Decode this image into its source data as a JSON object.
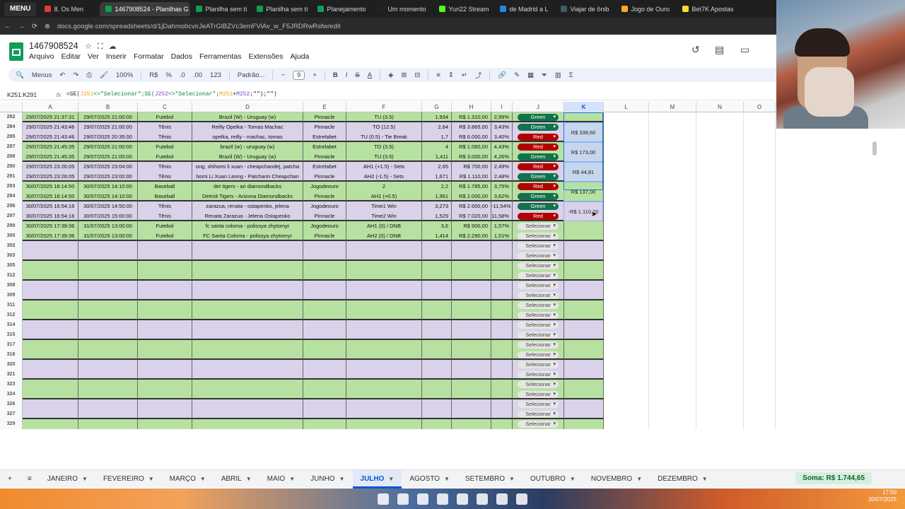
{
  "browser": {
    "menu_label": "MENU",
    "tabs": [
      {
        "label": "8. Os Men",
        "color": "#e53935"
      },
      {
        "label": "1467908524 - Planilhas G",
        "color": "#0f9d58",
        "active": true
      },
      {
        "label": "Planilha sem tí",
        "color": "#0f9d58"
      },
      {
        "label": "Planilha sem tí",
        "color": "#0f9d58"
      },
      {
        "label": "Planejamento",
        "color": "#0f9d58"
      },
      {
        "label": "Um momento",
        "color": "#222222"
      },
      {
        "label": "Yuri22 Stream",
        "color": "#53fc18"
      },
      {
        "label": "de Madrid a L",
        "color": "#1e88e5"
      },
      {
        "label": "Viajar de ônib",
        "color": "#455a64"
      },
      {
        "label": "Jogo de Ouro",
        "color": "#f9a825"
      },
      {
        "label": "Bet7K Apostas",
        "color": "#fdd835"
      }
    ],
    "url": "docs.google.com/spreadsheets/d/1jDahmobcvirJeATrGlBZVc3emFVlAv_w_F5JRDRwRsfw/edit"
  },
  "doc": {
    "title": "1467908524",
    "menus": [
      "Arquivo",
      "Editar",
      "Ver",
      "Inserir",
      "Formatar",
      "Dados",
      "Ferramentas",
      "Extensões",
      "Ajuda"
    ]
  },
  "toolbar": {
    "search": "Menus",
    "zoom": "100%",
    "currency": "R$",
    "percent": "%",
    "dec_less": ".0",
    "dec_more": ".00",
    "num_format": "123",
    "font": "Padrão...",
    "font_size": "9"
  },
  "formula_bar": {
    "name_box": "K251:K291",
    "fx": "fx",
    "f1": "=SE(",
    "f2": "J251",
    "f3": "<>\"Selecionar\";SE(",
    "f4": "J252",
    "f5": "<>\"Selecionar\";",
    "f6": "M251",
    "f7": "+",
    "f8": "M252",
    "f9": ";\"\");\"\")"
  },
  "columns": [
    "A",
    "B",
    "C",
    "D",
    "E",
    "F",
    "G",
    "H",
    "I",
    "J",
    "K",
    "L",
    "M",
    "N",
    "O"
  ],
  "rows": [
    {
      "n": "282",
      "a": "29/07/2025 21:37:31",
      "b": "29/07/2025 21:00:00",
      "c": "Futebol",
      "d": "Brazil (W) - Uruguay (w)",
      "e": "Pinnacle",
      "f": "TU (3.5)",
      "g": "1,934",
      "h": "R$ 1.310,00",
      "i": "2,99%",
      "j": "Green",
      "bg": "g",
      "end": true
    },
    {
      "n": "284",
      "a": "29/07/2025 21:43:46",
      "b": "29/07/2025 21:00:00",
      "c": "Tênis",
      "d": "Reilly Opelka - Tomas Machac",
      "e": "Pinnacle",
      "f": "TO (12.5)",
      "g": "2,64",
      "h": "R$ 3.865,00",
      "i": "3,43%",
      "j": "Green",
      "bg": "p"
    },
    {
      "n": "285",
      "a": "29/07/2025 21:43:46",
      "b": "29/07/2025 20:35:00",
      "c": "Tênis",
      "d": "opelka, reilly - machac, tomas",
      "e": "Estrelabet",
      "f": "TU (0.5) - Tie Break",
      "g": "1,7",
      "h": "R$ 6.000,00",
      "i": "3,40%",
      "j": "Red",
      "bg": "p",
      "end": true
    },
    {
      "n": "287",
      "a": "29/07/2025 21:45:35",
      "b": "29/07/2025 21:00:00",
      "c": "Futebol",
      "d": "brazil (w) - uruguay (w)",
      "e": "Estrelabet",
      "f": "TO (3.5)",
      "g": "4",
      "h": "R$ 1.060,00",
      "i": "4,43%",
      "j": "Red",
      "bg": "g"
    },
    {
      "n": "288",
      "a": "29/07/2025 21:45:35",
      "b": "29/07/2025 21:00:00",
      "c": "Futebol",
      "d": "Brazil (W) - Uruguay (w)",
      "e": "Pinnacle",
      "f": "TU (3.5)",
      "g": "1,411",
      "h": "R$ 3.000,00",
      "i": "4,26%",
      "j": "Green",
      "bg": "g",
      "end": true
    },
    {
      "n": "290",
      "a": "29/07/2025 23:26:05",
      "b": "29/07/2025 23:04:00",
      "c": "Tênis",
      "d": "ong, shihomi li xuan - cheapchandej, patcha",
      "e": "Estrelabet",
      "f": "AH1 (+1.5) - Sets",
      "g": "2,65",
      "h": "R$ 700,00",
      "i": "2,49%",
      "j": "Red",
      "bg": "p"
    },
    {
      "n": "291",
      "a": "29/07/2025 23:26:05",
      "b": "29/07/2025 23:00:00",
      "c": "Tênis",
      "d": "homi Li Xuan Leong - Patcharin Cheapchan",
      "e": "Pinnacle",
      "f": "AH2 (-1.5) - Sets",
      "g": "1,671",
      "h": "R$ 1.110,00",
      "i": "2,48%",
      "j": "Green",
      "bg": "p",
      "end": true
    },
    {
      "n": "293",
      "a": "30/07/2025 16:14:50",
      "b": "30/07/2025 14:10:00",
      "c": "Baseball",
      "d": "det tigers - ari diamondbacks",
      "e": "Jogodeouro",
      "f": "2",
      "g": "2,2",
      "h": "R$ 1.785,00",
      "i": "3,75%",
      "j": "Red",
      "bg": "g"
    },
    {
      "n": "294",
      "a": "30/07/2025 16:14:50",
      "b": "30/07/2025 14:10:00",
      "c": "Baseball",
      "d": "Detroit Tigers - Arizona Diamondbacks",
      "e": "Pinnacle",
      "f": "AH1 (+0.5)",
      "g": "1,961",
      "h": "R$ 2.000,00",
      "i": "3,62%",
      "j": "Green",
      "bg": "g",
      "end": true
    },
    {
      "n": "296",
      "a": "30/07/2025 16:54:16",
      "b": "30/07/2025 14:50:00",
      "c": "Tênis",
      "d": "zarazua, renata - ostapenko, jelena",
      "e": "Jogodeouro",
      "f": "Time1 Win",
      "g": "3,273",
      "h": "R$ 2.600,00",
      "i": "-11,54%",
      "j": "Green",
      "bg": "p"
    },
    {
      "n": "297",
      "a": "30/07/2025 16:54:16",
      "b": "30/07/2025 15:00:00",
      "c": "Tênis",
      "d": "Renata Zarazua - Jelena Ostapenko",
      "e": "Pinnacle",
      "f": "Time2 Win",
      "g": "1,529",
      "h": "R$ 7.020,00",
      "i": "11,58%",
      "j": "Red",
      "bg": "p",
      "end": true
    },
    {
      "n": "299",
      "a": "30/07/2025 17:39:36",
      "b": "31/07/2025 13:00:00",
      "c": "Futebol",
      "d": "fc santa coloma - polissya zhytomyr",
      "e": "Jogodeouro",
      "f": "AH1 (0) / DNB",
      "g": "3,6",
      "h": "R$ 900,00",
      "i": "1,57%",
      "j": "Selecionar",
      "bg": "g"
    },
    {
      "n": "300",
      "a": "30/07/2025 17:39:36",
      "b": "31/07/2025 13:00:00",
      "c": "Futebol",
      "d": "FC Santa Coloma - polissya zhytomyr",
      "e": "Pinnacle",
      "f": "AH2 (0) / DNB",
      "g": "1,414",
      "h": "R$ 2.290,00",
      "i": "1,51%",
      "j": "Selecionar",
      "bg": "g",
      "end": true
    },
    {
      "n": "302",
      "a": "",
      "b": "",
      "c": "",
      "d": "",
      "e": "",
      "f": "",
      "g": "",
      "h": "",
      "i": "",
      "j": "Selecionar",
      "bg": "p"
    },
    {
      "n": "303",
      "a": "",
      "b": "",
      "c": "",
      "d": "",
      "e": "",
      "f": "",
      "g": "",
      "h": "",
      "i": "",
      "j": "Selecionar",
      "bg": "p",
      "end": true
    },
    {
      "n": "305",
      "a": "",
      "b": "",
      "c": "",
      "d": "",
      "e": "",
      "f": "",
      "g": "",
      "h": "",
      "i": "",
      "j": "Selecionar",
      "bg": "g"
    },
    {
      "n": "312",
      "a": "",
      "b": "",
      "c": "",
      "d": "",
      "e": "",
      "f": "",
      "g": "",
      "h": "",
      "i": "",
      "j": "Selecionar",
      "bg": "g",
      "end": true
    },
    {
      "n": "308",
      "a": "",
      "b": "",
      "c": "",
      "d": "",
      "e": "",
      "f": "",
      "g": "",
      "h": "",
      "i": "",
      "j": "Selecionar",
      "bg": "p"
    },
    {
      "n": "309",
      "a": "",
      "b": "",
      "c": "",
      "d": "",
      "e": "",
      "f": "",
      "g": "",
      "h": "",
      "i": "",
      "j": "Selecionar",
      "bg": "p",
      "end": true
    },
    {
      "n": "311",
      "a": "",
      "b": "",
      "c": "",
      "d": "",
      "e": "",
      "f": "",
      "g": "",
      "h": "",
      "i": "",
      "j": "Selecionar",
      "bg": "g"
    },
    {
      "n": "312",
      "a": "",
      "b": "",
      "c": "",
      "d": "",
      "e": "",
      "f": "",
      "g": "",
      "h": "",
      "i": "",
      "j": "Selecionar",
      "bg": "g",
      "end": true
    },
    {
      "n": "314",
      "a": "",
      "b": "",
      "c": "",
      "d": "",
      "e": "",
      "f": "",
      "g": "",
      "h": "",
      "i": "",
      "j": "Selecionar",
      "bg": "p"
    },
    {
      "n": "315",
      "a": "",
      "b": "",
      "c": "",
      "d": "",
      "e": "",
      "f": "",
      "g": "",
      "h": "",
      "i": "",
      "j": "Selecionar",
      "bg": "p",
      "end": true
    },
    {
      "n": "317",
      "a": "",
      "b": "",
      "c": "",
      "d": "",
      "e": "",
      "f": "",
      "g": "",
      "h": "",
      "i": "",
      "j": "Selecionar",
      "bg": "g"
    },
    {
      "n": "318",
      "a": "",
      "b": "",
      "c": "",
      "d": "",
      "e": "",
      "f": "",
      "g": "",
      "h": "",
      "i": "",
      "j": "Selecionar",
      "bg": "g",
      "end": true
    },
    {
      "n": "320",
      "a": "",
      "b": "",
      "c": "",
      "d": "",
      "e": "",
      "f": "",
      "g": "",
      "h": "",
      "i": "",
      "j": "Selecionar",
      "bg": "p"
    },
    {
      "n": "321",
      "a": "",
      "b": "",
      "c": "",
      "d": "",
      "e": "",
      "f": "",
      "g": "",
      "h": "",
      "i": "",
      "j": "Selecionar",
      "bg": "p",
      "end": true
    },
    {
      "n": "323",
      "a": "",
      "b": "",
      "c": "",
      "d": "",
      "e": "",
      "f": "",
      "g": "",
      "h": "",
      "i": "",
      "j": "Selecionar",
      "bg": "g"
    },
    {
      "n": "324",
      "a": "",
      "b": "",
      "c": "",
      "d": "",
      "e": "",
      "f": "",
      "g": "",
      "h": "",
      "i": "",
      "j": "Selecionar",
      "bg": "g",
      "end": true
    },
    {
      "n": "326",
      "a": "",
      "b": "",
      "c": "",
      "d": "",
      "e": "",
      "f": "",
      "g": "",
      "h": "",
      "i": "",
      "j": "Selecionar",
      "bg": "p"
    },
    {
      "n": "327",
      "a": "",
      "b": "",
      "c": "",
      "d": "",
      "e": "",
      "f": "",
      "g": "",
      "h": "",
      "i": "",
      "j": "Selecionar",
      "bg": "p",
      "end": true
    },
    {
      "n": "329",
      "a": "",
      "b": "",
      "c": "",
      "d": "",
      "e": "",
      "f": "",
      "g": "",
      "h": "",
      "i": "",
      "j": "Selecionar",
      "bg": "g"
    }
  ],
  "k_totals": [
    "R$ 338,60",
    "R$ 173,00",
    "R$ 44,81",
    "R$ 137,00",
    "-R$ 1.110,20"
  ],
  "sheet_tabs": [
    "JANEIRO",
    "FEVEREIRO",
    "MARÇO",
    "ABRIL",
    "MAIO",
    "JUNHO",
    "JULHO",
    "AGOSTO",
    "SETEMBRO",
    "OUTUBRO",
    "NOVEMBRO",
    "DEZEMBRO"
  ],
  "active_sheet": "JULHO",
  "sum_label": "Soma: R$ 1.744,65",
  "clock": {
    "time": "17:50",
    "date": "30/07/2025"
  },
  "colors": {
    "green_row": "#b7e1a1",
    "purple_row": "#d9d2e9",
    "green_pill": "#11734b",
    "red_pill": "#b10202",
    "accent": "#0b57d0"
  }
}
